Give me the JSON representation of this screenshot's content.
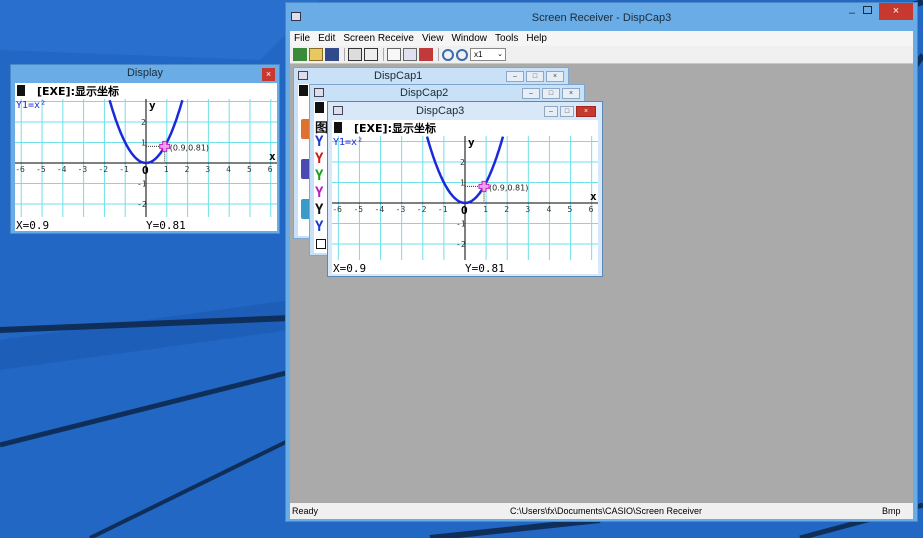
{
  "desktop": {
    "background": "#2267c4"
  },
  "display_window": {
    "title": "Display",
    "close": "×",
    "header": "[EXE]:显示坐标",
    "func": "Y1=x²",
    "x_readout": "X=0.9",
    "y_readout": "Y=0.81",
    "point_label": "(0.9,0.81)",
    "axis_x": "x",
    "axis_y": "y",
    "origin": "O",
    "x_ticks": [
      "-6",
      "-5",
      "-4",
      "-3",
      "-2",
      "-1",
      "1",
      "2",
      "3",
      "4",
      "5",
      "6"
    ],
    "y_ticks": [
      "2",
      "1",
      "-1",
      "-2"
    ]
  },
  "main_window": {
    "title": "Screen Receiver - DispCap3",
    "menu": [
      "File",
      "Edit",
      "Screen Receive",
      "View",
      "Window",
      "Tools",
      "Help"
    ],
    "zoom": "x1",
    "status": {
      "left": "Ready",
      "path": "C:\\Users\\fx\\Documents\\CASIO\\Screen Receiver",
      "format": "Bmp"
    },
    "child1_title": "DispCap1",
    "child2_title": "DispCap2",
    "child3_title": "DispCap3",
    "child2_letters": [
      "图",
      "Y",
      "Y",
      "Y",
      "Y",
      "Y",
      "Y"
    ]
  },
  "graph": {
    "function": "x^2",
    "point": [
      0.9,
      0.81
    ]
  }
}
